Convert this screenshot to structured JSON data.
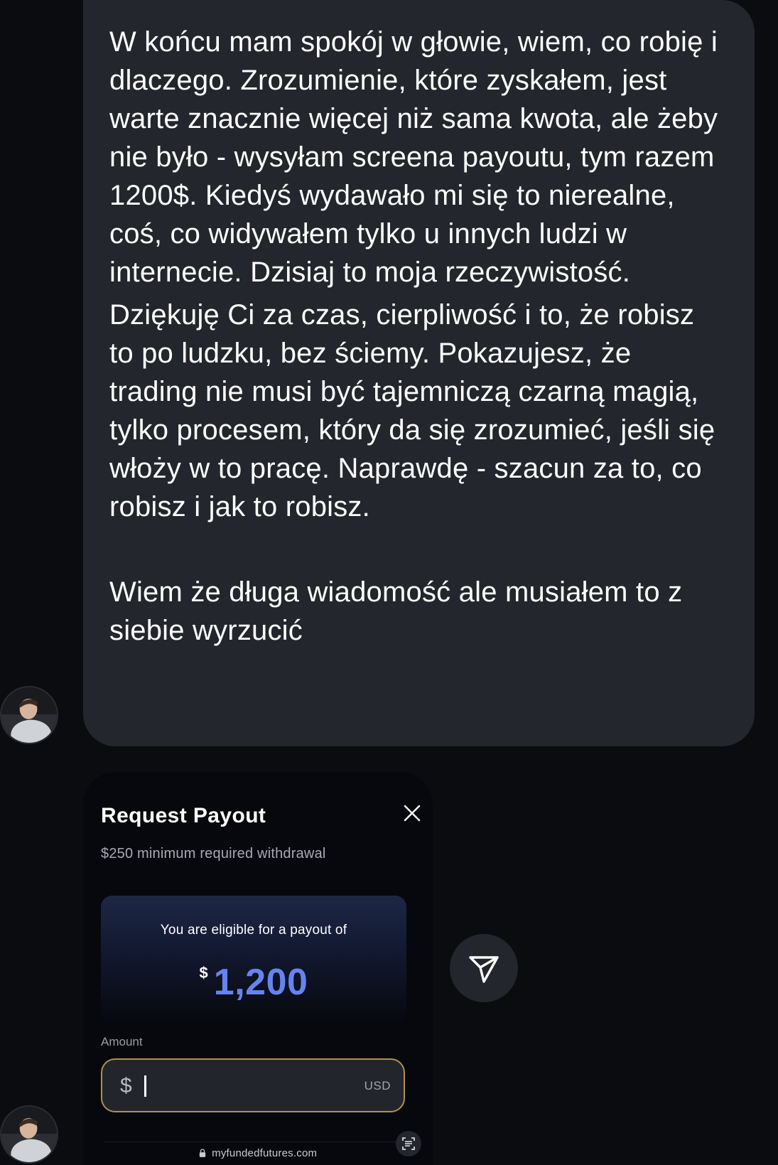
{
  "message": {
    "paragraph1": "W końcu mam spokój w głowie, wiem, co robię i dlaczego. Zrozumienie, które zyskałem, jest warte znacznie więcej niż sama kwota, ale żeby nie było - wysyłam screena payoutu, tym razem 1200$. Kiedyś wydawało mi się to nierealne, coś, co widywałem tylko u innych ludzi w internecie. Dzisiaj to moja rzeczywistość.",
    "paragraph2": "Dziękuję Ci za czas, cierpliwość i to, że robisz to po ludzku, bez ściemy. Pokazujesz, że trading nie musi być tajemniczą czarną magią, tylko procesem, który da się zrozumieć, jeśli się włoży w to pracę. Naprawdę - szacun za to, co robisz i jak to robisz.",
    "paragraph3": "Wiem że długa wiadomość ale musiałem to z siebie wyrzucić"
  },
  "payout": {
    "title": "Request Payout",
    "subtitle": "$250 minimum required withdrawal",
    "eligible_text": "You are eligible for a payout of",
    "currency_symbol": "$",
    "eligible_amount": "1,200",
    "amount_label": "Amount",
    "amount_prefix": "$",
    "amount_suffix": "USD",
    "url": "myfundedfutures.com"
  },
  "icons": {
    "close": "close-icon",
    "send": "send-icon",
    "lock": "lock-icon",
    "scan": "scan-text-icon",
    "avatar": "avatar"
  },
  "colors": {
    "background": "#0b0c10",
    "bubble": "#23262c",
    "accent_blue": "#6684ef",
    "input_border": "#b18f4d"
  }
}
